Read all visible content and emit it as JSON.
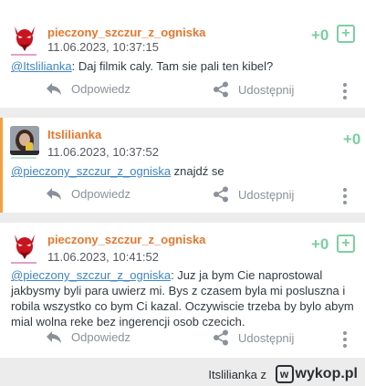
{
  "comments": [
    {
      "author": "pieczony_szczur_z_ogniska",
      "date": "11.06.2023, 10:37:15",
      "score": "+0",
      "plus": "+",
      "mention": "@Itslilianka",
      "text": ": Daj filmik caly. Tam sie pali ten kibel?",
      "reply_label": "Odpowiedz",
      "share_label": "Udostępnij"
    },
    {
      "author": "Itslilianka",
      "date": "11.06.2023, 10:37:52",
      "score": "+0",
      "mention": "@pieczony_szczur_z_ogniska",
      "text": " znajdź se",
      "reply_label": "Odpowiedz",
      "share_label": "Udostępnij"
    },
    {
      "author": "pieczony_szczur_z_ogniska",
      "date": "11.06.2023, 10:41:52",
      "score": "+0",
      "plus": "+",
      "mention": "@pieczony_szczur_z_ogniska",
      "text": ": Juz ja bym Cie naprostowal jakbysmy byli para uwierz mi. Bys z czasem byla mi posluszna i robila wszystko co bym Ci kazal. Oczywiscie trzeba by bylo abym mial wolna reke bez ingerencji osob czecich.",
      "reply_label": "Odpowiedz",
      "share_label": "Udostępnij"
    }
  ],
  "footer": {
    "user": "Itslilianka z",
    "logo_letter": "w",
    "logo_text": "wykop.pl"
  },
  "colors": {
    "author": "#e6772e",
    "mention": "#3e84c4",
    "vote": "#7ccfa2",
    "accent": "#f4a13f"
  }
}
